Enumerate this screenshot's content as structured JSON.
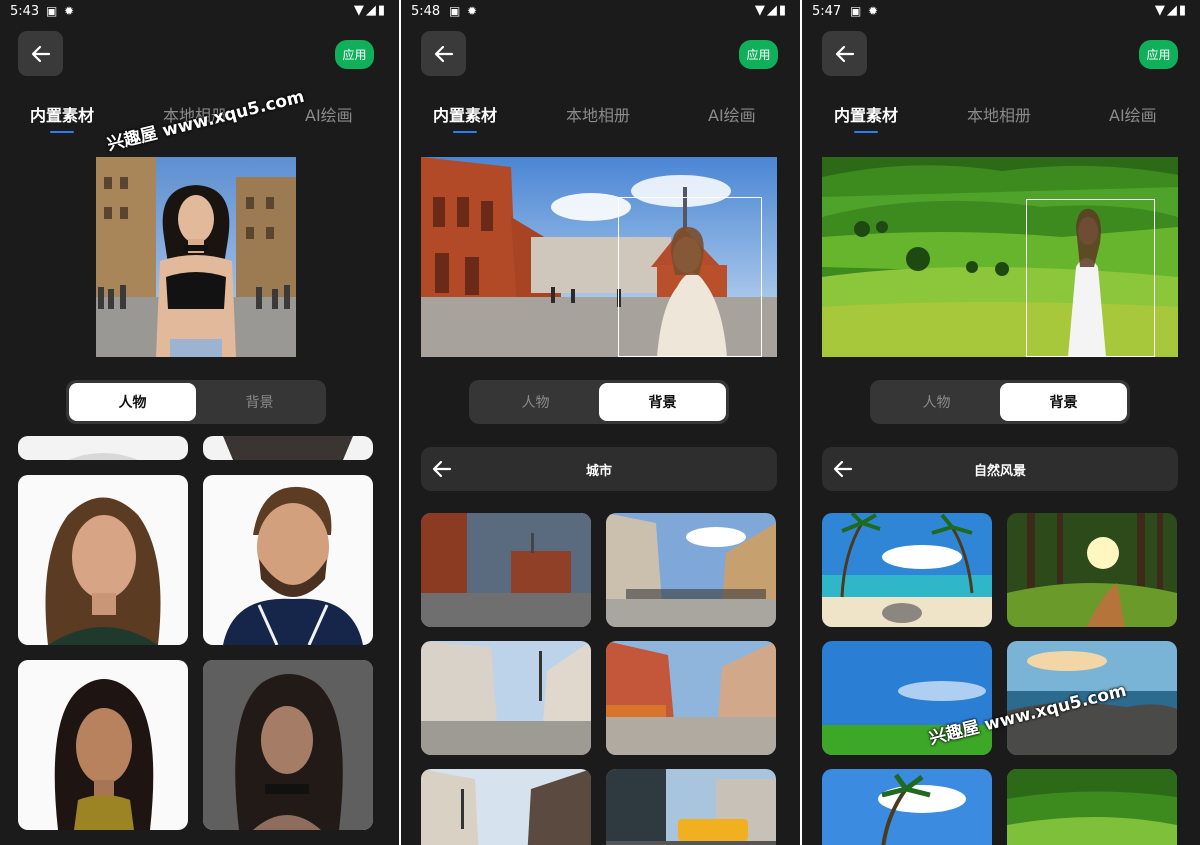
{
  "screens": [
    {
      "status_time": "5:43",
      "apply_label": "应用",
      "tabs": [
        "内置素材",
        "本地相册",
        "AI绘画"
      ],
      "segment": [
        "人物",
        "背景"
      ],
      "active_segment": "人物"
    },
    {
      "status_time": "5:48",
      "apply_label": "应用",
      "tabs": [
        "内置素材",
        "本地相册",
        "AI绘画"
      ],
      "segment": [
        "人物",
        "背景"
      ],
      "active_segment": "背景",
      "category": "城市"
    },
    {
      "status_time": "5:47",
      "apply_label": "应用",
      "tabs": [
        "内置素材",
        "本地相册",
        "AI绘画"
      ],
      "segment": [
        "人物",
        "背景"
      ],
      "active_segment": "背景",
      "category": "自然风景"
    }
  ],
  "watermark": "兴趣屋 www.xqu5.com",
  "colors": {
    "background": "#1b1b1b",
    "accent_green": "#10b05b",
    "tab_underline": "#2f7df6",
    "segment_bg": "#363636"
  },
  "icons": [
    "back-arrow-icon",
    "wifi-icon",
    "battery-icon",
    "settings-icon",
    "notification-icon"
  ]
}
